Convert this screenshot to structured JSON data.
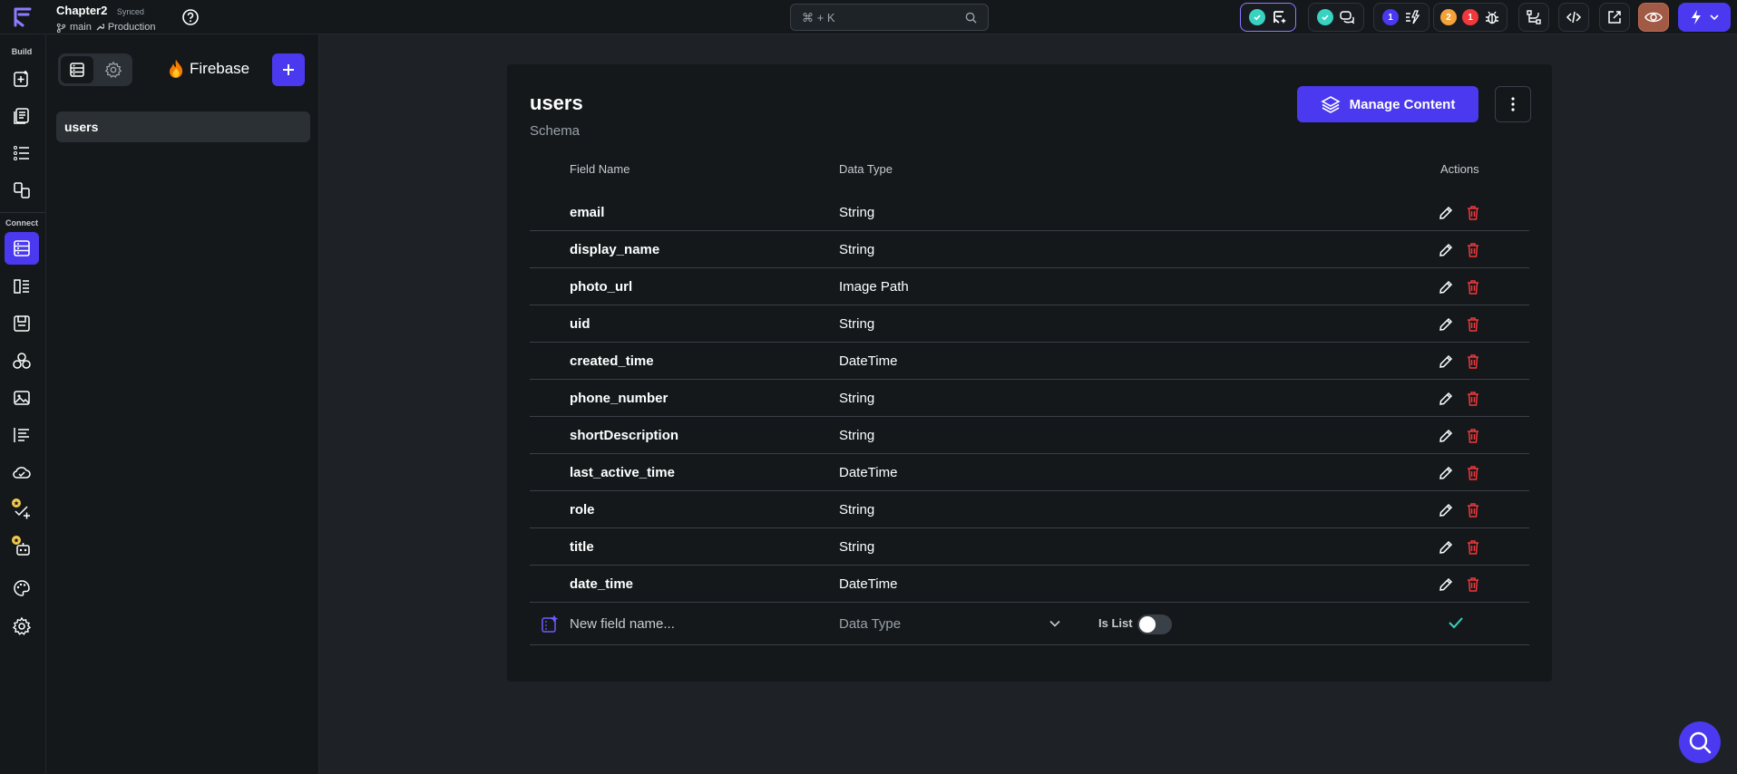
{
  "app": {
    "project_name": "Chapter2",
    "sync_status": "Synced",
    "branch": "main",
    "environment": "Production"
  },
  "search": {
    "placeholder": "⌘ + K"
  },
  "toolbar": {
    "badge_blue_count": "1",
    "badge_orange_count": "2",
    "badge_red_count": "1"
  },
  "rail": {
    "build_label": "Build",
    "connect_label": "Connect"
  },
  "panel": {
    "brand": "Firebase",
    "collections": [
      {
        "name": "users"
      }
    ]
  },
  "schema": {
    "title": "users",
    "subtitle": "Schema",
    "manage_label": "Manage Content",
    "columns": {
      "field_name": "Field Name",
      "data_type": "Data Type",
      "actions": "Actions"
    },
    "fields": [
      {
        "name": "email",
        "type": "String"
      },
      {
        "name": "display_name",
        "type": "String"
      },
      {
        "name": "photo_url",
        "type": "Image Path"
      },
      {
        "name": "uid",
        "type": "String"
      },
      {
        "name": "created_time",
        "type": "DateTime"
      },
      {
        "name": "phone_number",
        "type": "String"
      },
      {
        "name": "shortDescription",
        "type": "String"
      },
      {
        "name": "last_active_time",
        "type": "DateTime"
      },
      {
        "name": "role",
        "type": "String"
      },
      {
        "name": "title",
        "type": "String"
      },
      {
        "name": "date_time",
        "type": "DateTime"
      }
    ],
    "new_field": {
      "placeholder": "New field name...",
      "data_type_placeholder": "Data Type",
      "is_list_label": "Is List"
    }
  },
  "colors": {
    "accent": "#4b39ef",
    "success": "#39d2c0",
    "danger": "#ef393c",
    "warning": "#f2a33a"
  }
}
